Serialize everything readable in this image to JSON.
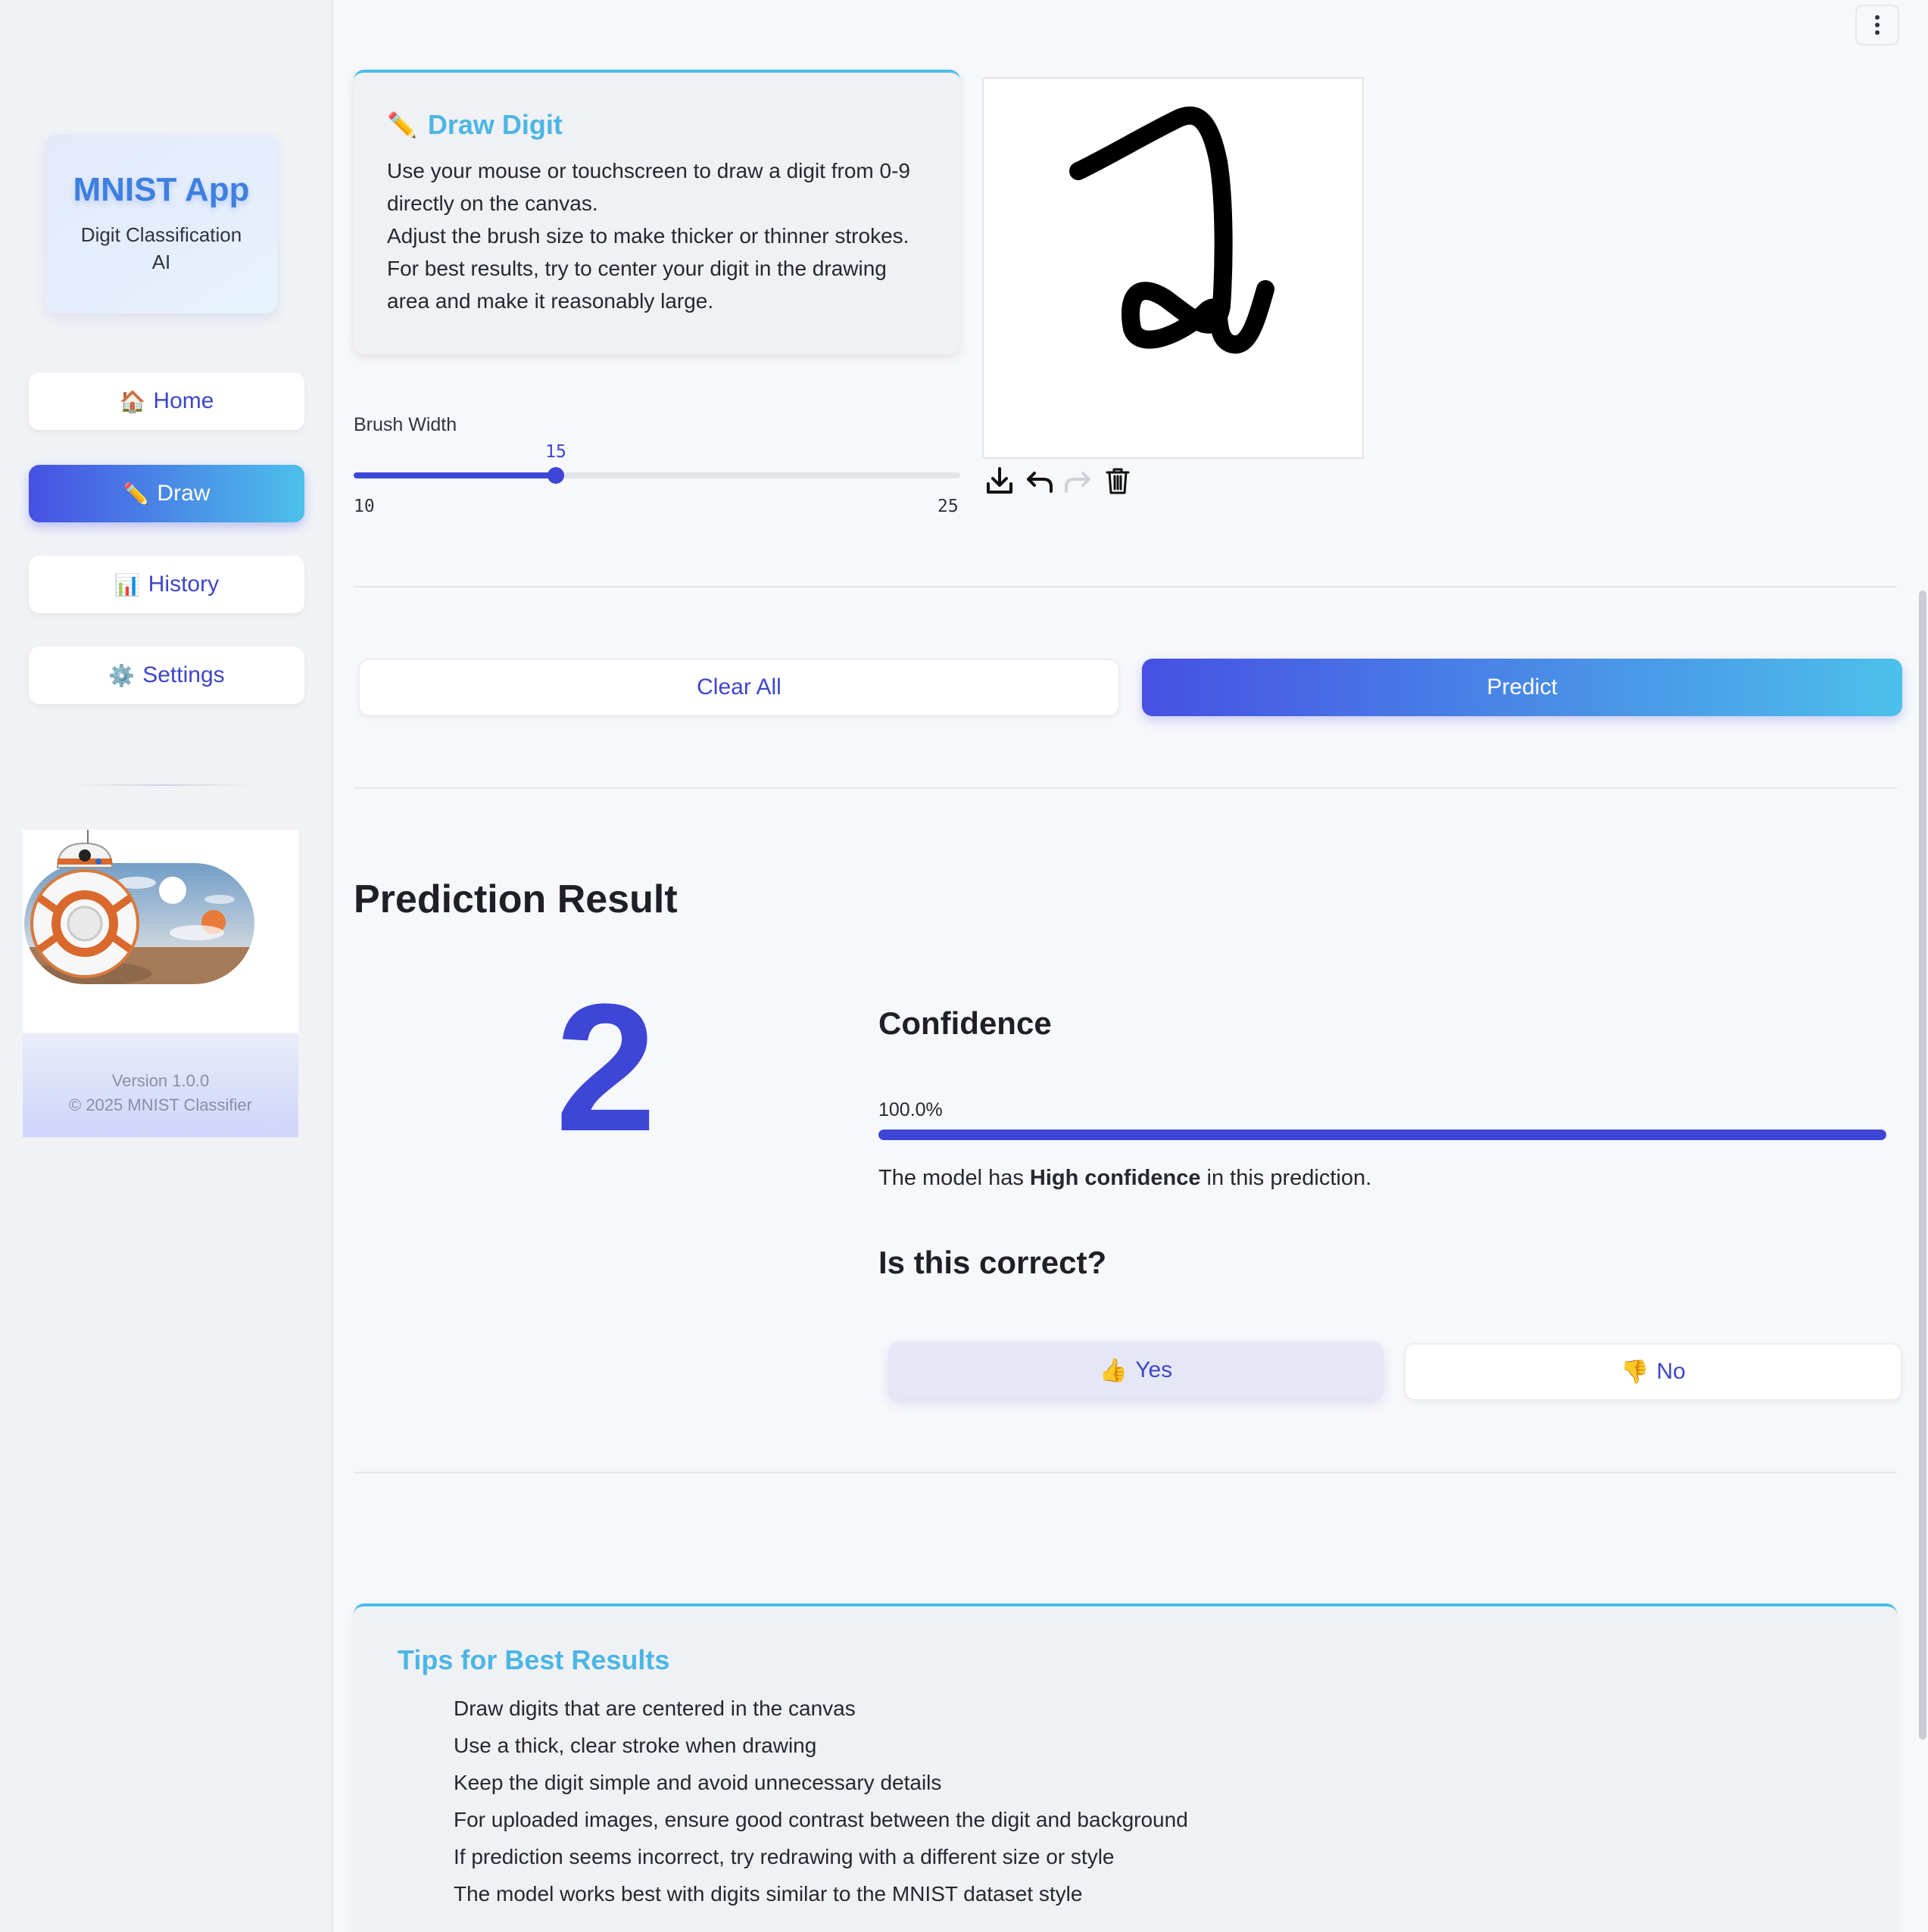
{
  "sidebar": {
    "brand_title": "MNIST App",
    "brand_subtitle": "Digit Classification AI",
    "nav": [
      {
        "label": "Home",
        "icon": "🏠"
      },
      {
        "label": "Draw",
        "icon": "✏️"
      },
      {
        "label": "History",
        "icon": "📊"
      },
      {
        "label": "Settings",
        "icon": "⚙️"
      }
    ],
    "active": "Draw",
    "version": "Version 1.0.0",
    "copyright": "© 2025 MNIST Classifier"
  },
  "draw_card": {
    "icon": "✏️",
    "title": "Draw Digit",
    "desc_line1": "Use your mouse or touchscreen to draw a digit from 0-9 directly on the canvas.",
    "desc_line2": "Adjust the brush size to make thicker or thinner strokes. For best results, try to center your digit in the drawing area and make it reasonably large."
  },
  "brush": {
    "label": "Brush Width",
    "value": 15,
    "min": 10,
    "max": 25
  },
  "actions": {
    "clear_label": "Clear All",
    "predict_label": "Predict"
  },
  "result": {
    "title": "Prediction Result",
    "digit": "2",
    "confidence_title": "Confidence",
    "confidence_value": "100.0%",
    "confidence_fraction": 1.0,
    "confidence_text_pre": "The model has ",
    "confidence_text_bold": "High confidence",
    "confidence_text_post": " in this prediction.",
    "correct_title": "Is this correct?",
    "yes_icon": "👍",
    "yes_label": "Yes",
    "no_icon": "👎",
    "no_label": "No"
  },
  "tips": {
    "title": "Tips for Best Results",
    "items": [
      "Draw digits that are centered in the canvas",
      "Use a thick, clear stroke when drawing",
      "Keep the digit simple and avoid unnecessary details",
      "For uploaded images, ensure good contrast between the digit and background",
      "If prediction seems incorrect, try redrawing with a different size or style",
      "The model works best with digits similar to the MNIST dataset style"
    ]
  },
  "colors": {
    "accent": "#3d46d6",
    "gradient_start": "#4650e3",
    "gradient_end": "#4cc0ea",
    "title_blue": "#4bb6e4"
  }
}
